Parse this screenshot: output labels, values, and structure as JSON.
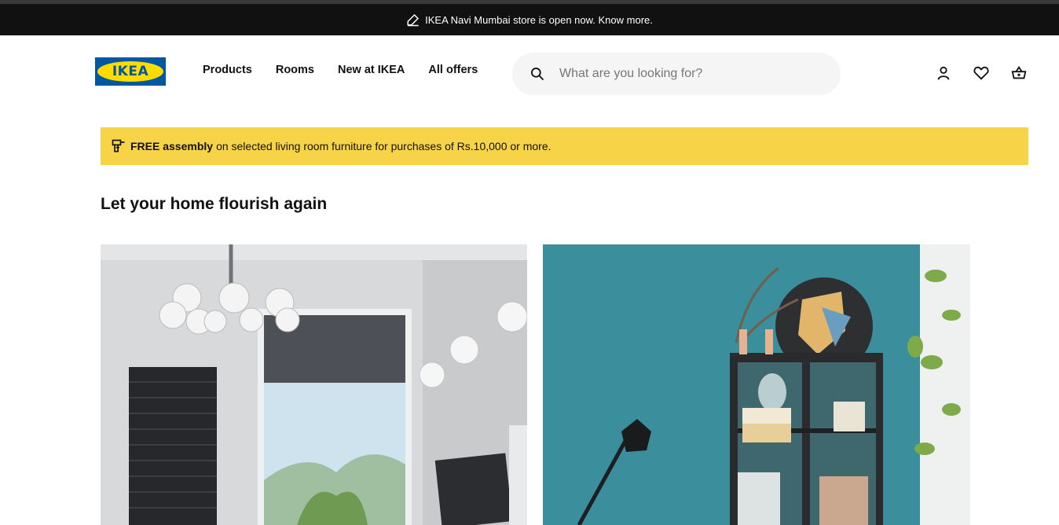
{
  "announcement": {
    "text": "IKEA Navi Mumbai store is open now. Know more."
  },
  "logo": {
    "text": "IKEA"
  },
  "nav": [
    {
      "label": "Products"
    },
    {
      "label": "Rooms"
    },
    {
      "label": "New at IKEA"
    },
    {
      "label": "All offers"
    }
  ],
  "search": {
    "placeholder": "What are you looking for?"
  },
  "header_icons": [
    "profile-icon",
    "heart-icon",
    "cart-icon"
  ],
  "banner": {
    "bold": "FREE assembly",
    "text": "on selected living room furniture for purchases of Rs.10,000 or more.",
    "color": "#f7d347"
  },
  "section": {
    "heading": "Let your home flourish again"
  },
  "colors": {
    "brand_blue": "#0058a3",
    "brand_yellow": "#ffdb00"
  }
}
